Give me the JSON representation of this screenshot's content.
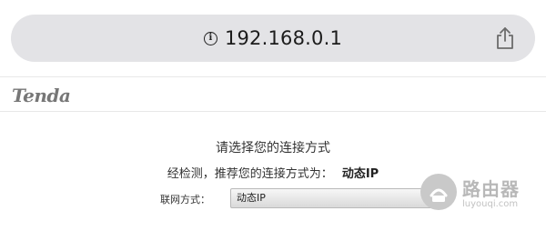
{
  "browser": {
    "url": "192.168.0.1",
    "info_icon": "info-icon",
    "share_icon": "share-icon"
  },
  "header": {
    "logo_text": "Tenda"
  },
  "main": {
    "title": "请选择您的连接方式",
    "recommend_prefix": "经检测，推荐您的连接方式为：",
    "recommend_value": "动态IP",
    "connection_label": "联网方式：",
    "connection_selected": "动态IP"
  },
  "watermark": {
    "main": "路由器",
    "sub": "luyouqi.com"
  }
}
